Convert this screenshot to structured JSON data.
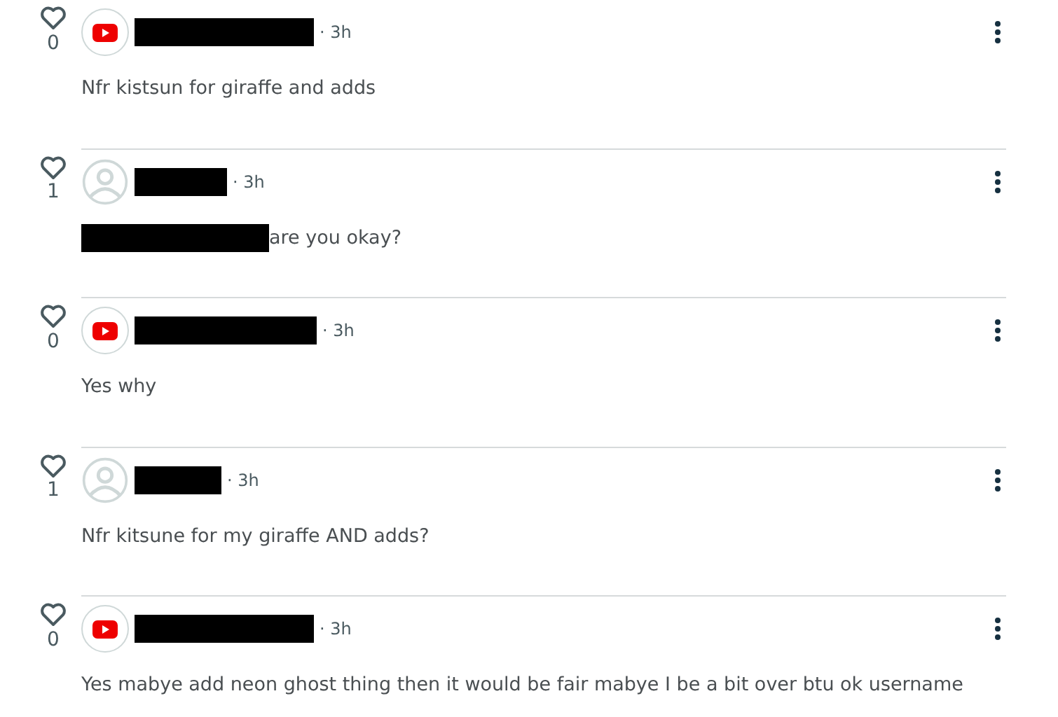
{
  "comments": [
    {
      "likes": "0",
      "kind": "youtube",
      "time": "· 3h",
      "mention_redacted": false,
      "text": "Nfr kistsun for giraffe and adds"
    },
    {
      "likes": "1",
      "kind": "default",
      "time": "· 3h",
      "mention_redacted": true,
      "text": "are you okay?"
    },
    {
      "likes": "0",
      "kind": "youtube",
      "time": "· 3h",
      "mention_redacted": false,
      "text": "Yes why"
    },
    {
      "likes": "1",
      "kind": "default",
      "time": "· 3h",
      "mention_redacted": false,
      "text": "Nfr kitsune for my giraffe AND adds?"
    },
    {
      "likes": "0",
      "kind": "youtube",
      "time": "· 3h",
      "mention_redacted": false,
      "text": "Yes mabye add neon ghost thing then it would be fair mabye I be a bit over btu ok username"
    }
  ]
}
